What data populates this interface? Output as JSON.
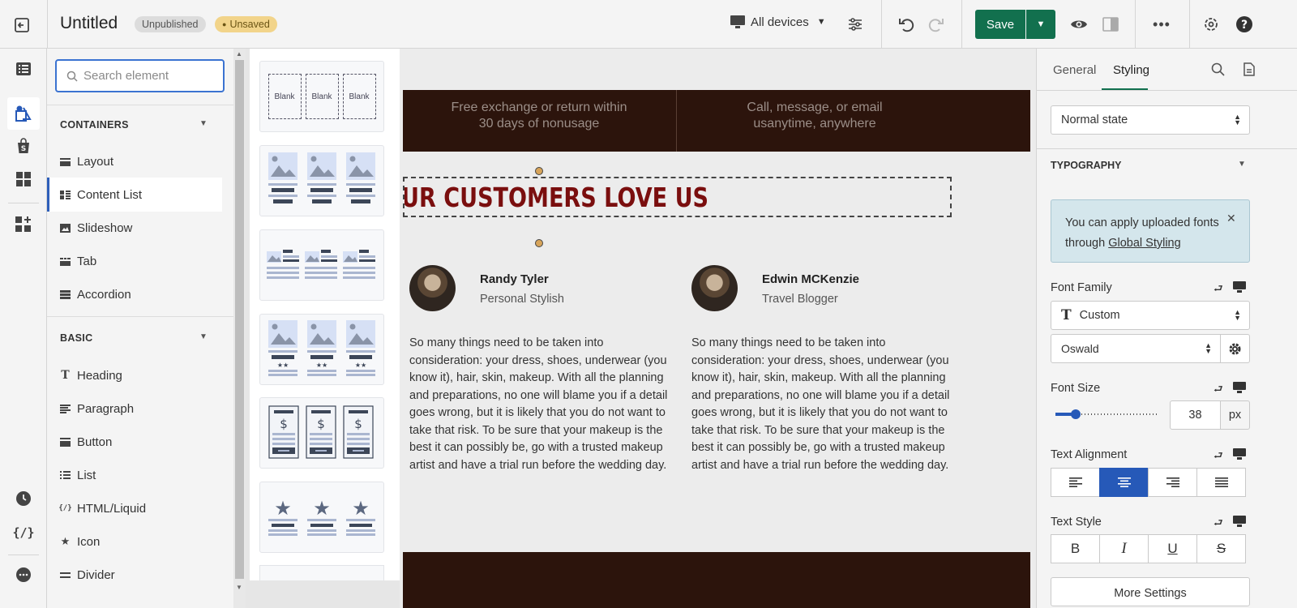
{
  "topbar": {
    "title": "Untitled",
    "badge_publish": "Unpublished",
    "badge_save": "Unsaved",
    "devices_label": "All devices",
    "save_label": "Save"
  },
  "elements_panel": {
    "search_placeholder": "Search element",
    "containers_heading": "CONTAINERS",
    "containers": [
      "Layout",
      "Content List",
      "Slideshow",
      "Tab",
      "Accordion"
    ],
    "basic_heading": "BASIC",
    "basic": [
      "Heading",
      "Paragraph",
      "Button",
      "List",
      "HTML/Liquid",
      "Icon",
      "Divider"
    ],
    "active_item": "Content List"
  },
  "templates": {
    "blank_label": "Blank"
  },
  "canvas": {
    "band_left": "Free exchange or return within\n30 days of nonusage",
    "band_right": "Call, message, or email\nusanytime, anywhere",
    "heading": "UR CUSTOMERS LOVE US",
    "testimonials": [
      {
        "name": "Randy Tyler",
        "role": "Personal Stylish",
        "body": "So many things need to be taken into consideration: your dress, shoes, underwear (you know it), hair, skin, makeup. With all the planning and preparations, no one will blame you if a detail goes wrong, but it is likely that you do not want to take that risk. To be sure that your makeup is the best it can possibly be, go with a trusted makeup artist and have a trial run before the wedding day."
      },
      {
        "name": "Edwin MCKenzie",
        "role": "Travel Blogger",
        "body": "So many things need to be taken into consideration: your dress, shoes, underwear (you know it), hair, skin, makeup. With all the planning and preparations, no one will blame you if a detail goes wrong, but it is likely that you do not want to take that risk. To be sure that your makeup is the best it can possibly be, go with a trusted makeup artist and have a trial run before the wedding day."
      }
    ]
  },
  "right_panel": {
    "tab_general": "General",
    "tab_styling": "Styling",
    "state_select": "Normal state",
    "typography_heading": "TYPOGRAPHY",
    "notice_text": "You can apply uploaded fonts through ",
    "notice_link": "Global Styling",
    "font_family_label": "Font Family",
    "font_family_value": "Custom",
    "font_name_value": "Oswald",
    "font_size_label": "Font Size",
    "font_size_value": "38",
    "font_size_unit": "px",
    "font_size_slider_fraction": 0.2,
    "text_alignment_label": "Text Alignment",
    "text_alignment_selected": "center",
    "text_style_label": "Text Style",
    "more_settings_label": "More Settings"
  },
  "colors": {
    "accent": "#2659b8",
    "save_green": "#12704e",
    "heading_red": "#7a0e0e",
    "band_brown": "#2c140c"
  }
}
